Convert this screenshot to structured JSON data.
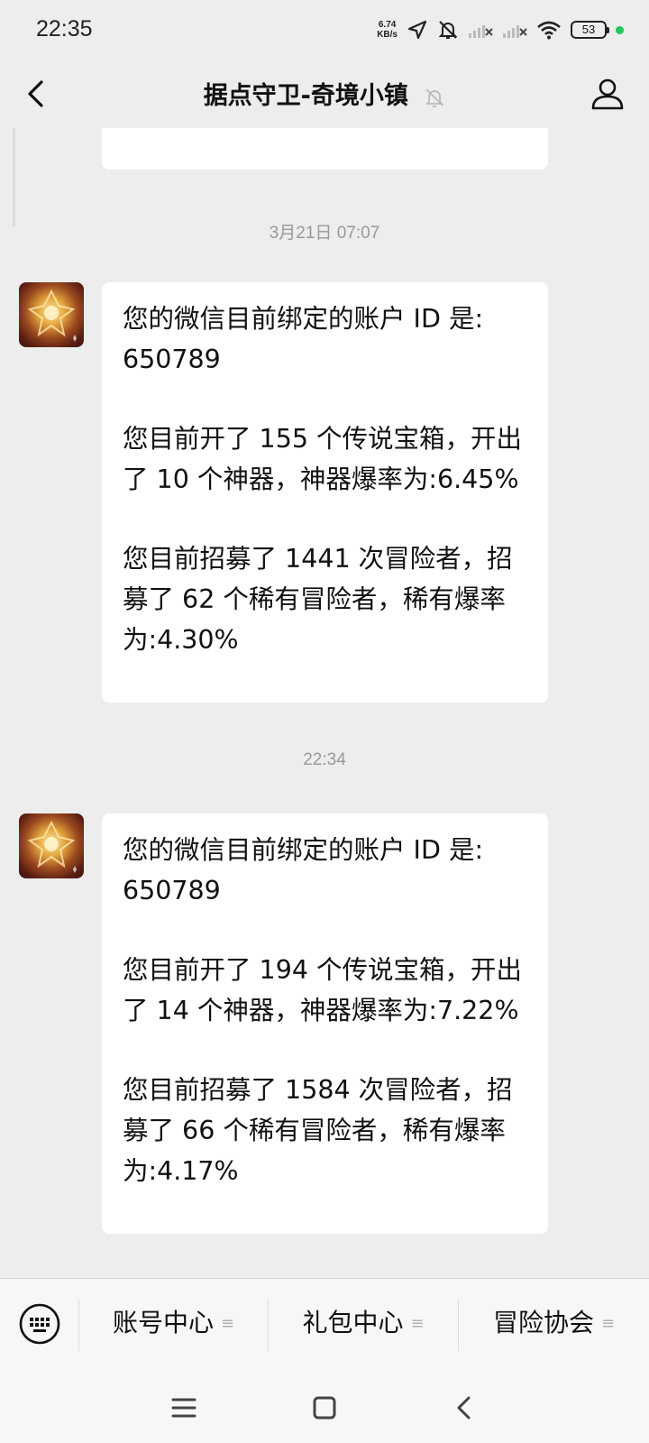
{
  "status_bar": {
    "time": "22:35",
    "net_speed_value": "6.74",
    "net_speed_unit": "KB/s",
    "battery": "53",
    "icons": [
      "location-arrow-icon",
      "bell-off-icon",
      "signal-icon",
      "signal-icon",
      "wifi-icon",
      "battery-icon",
      "green-dot"
    ]
  },
  "header": {
    "title": "据点守卫-奇境小镇",
    "back_icon": "chevron-left-icon",
    "mute_icon": "bell-off-icon",
    "profile_icon": "person-icon"
  },
  "messages": [
    {
      "timestamp": "3月21日 07:07",
      "paragraphs": [
        [
          "您的微信目前绑定的账户 ID 是:",
          "650789"
        ],
        [
          "您目前开了 155 个传说宝箱，开出",
          "了 10 个神器，神器爆率为:6.45%"
        ],
        [
          "您目前招募了 1441 次冒险者，招",
          "募了 62 个稀有冒险者，稀有爆率",
          "为:4.30%"
        ]
      ]
    },
    {
      "timestamp": "22:34",
      "paragraphs": [
        [
          "您的微信目前绑定的账户 ID 是:",
          "650789"
        ],
        [
          "您目前开了 194 个传说宝箱，开出",
          "了 14 个神器，神器爆率为:7.22%"
        ],
        [
          "您目前招募了 1584 次冒险者，招",
          "募了 66 个稀有冒险者，稀有爆率",
          "为:4.17%"
        ]
      ]
    }
  ],
  "bottom_menu": {
    "keyboard_icon": "keyboard-icon",
    "items": [
      "账号中心",
      "礼包中心",
      "冒险协会"
    ],
    "menu_marker": "≡"
  },
  "nav_bar": {
    "icons": [
      "menu-icon",
      "home-square-icon",
      "back-chevron-icon"
    ]
  },
  "colors": {
    "background": "#ededed",
    "bubble": "#ffffff",
    "timestamp": "#999999",
    "status_dot": "#22c55e"
  }
}
